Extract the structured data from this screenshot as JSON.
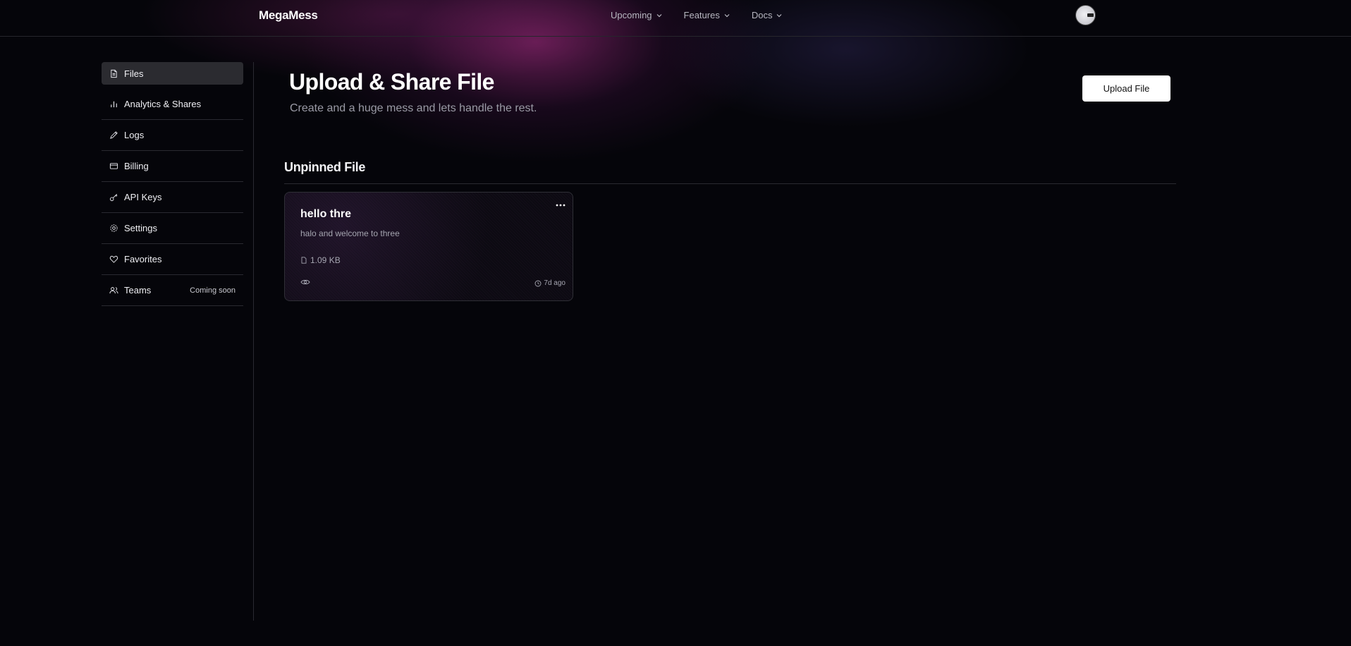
{
  "header": {
    "brand": "MegaMess",
    "nav": [
      {
        "label": "Upcoming",
        "icon": "chevron-down-icon"
      },
      {
        "label": "Features",
        "icon": "chevron-down-icon"
      },
      {
        "label": "Docs",
        "icon": "chevron-down-icon"
      }
    ],
    "avatar": "user-avatar"
  },
  "sidebar": {
    "items": [
      {
        "label": "Files",
        "icon": "file-icon",
        "active": true
      },
      {
        "label": "Analytics & Shares",
        "icon": "bar-chart-icon"
      },
      {
        "label": "Logs",
        "icon": "pen-icon"
      },
      {
        "label": "Billing",
        "icon": "credit-card-icon"
      },
      {
        "label": "API Keys",
        "icon": "key-icon"
      },
      {
        "label": "Settings",
        "icon": "gear-icon"
      },
      {
        "label": "Favorites",
        "icon": "heart-icon"
      },
      {
        "label": "Teams",
        "icon": "users-icon",
        "badge": "Coming soon"
      }
    ]
  },
  "main": {
    "title": "Upload & Share File",
    "subtitle": "Create and a huge mess and lets handle the rest.",
    "upload_button": "Upload File",
    "section_title": "Unpinned File",
    "files": [
      {
        "title": "hello thre",
        "description": "halo and welcome to three",
        "size": "1.09 KB",
        "time": "7d ago",
        "menu_icon": "more-horizontal-icon",
        "views_icon": "eye-icon",
        "time_icon": "clock-icon",
        "size_icon": "file-icon"
      }
    ]
  },
  "colors": {
    "background": "#05050a",
    "glow": "#962878",
    "active_item": "#2b2b30",
    "button": "#ffffff"
  }
}
